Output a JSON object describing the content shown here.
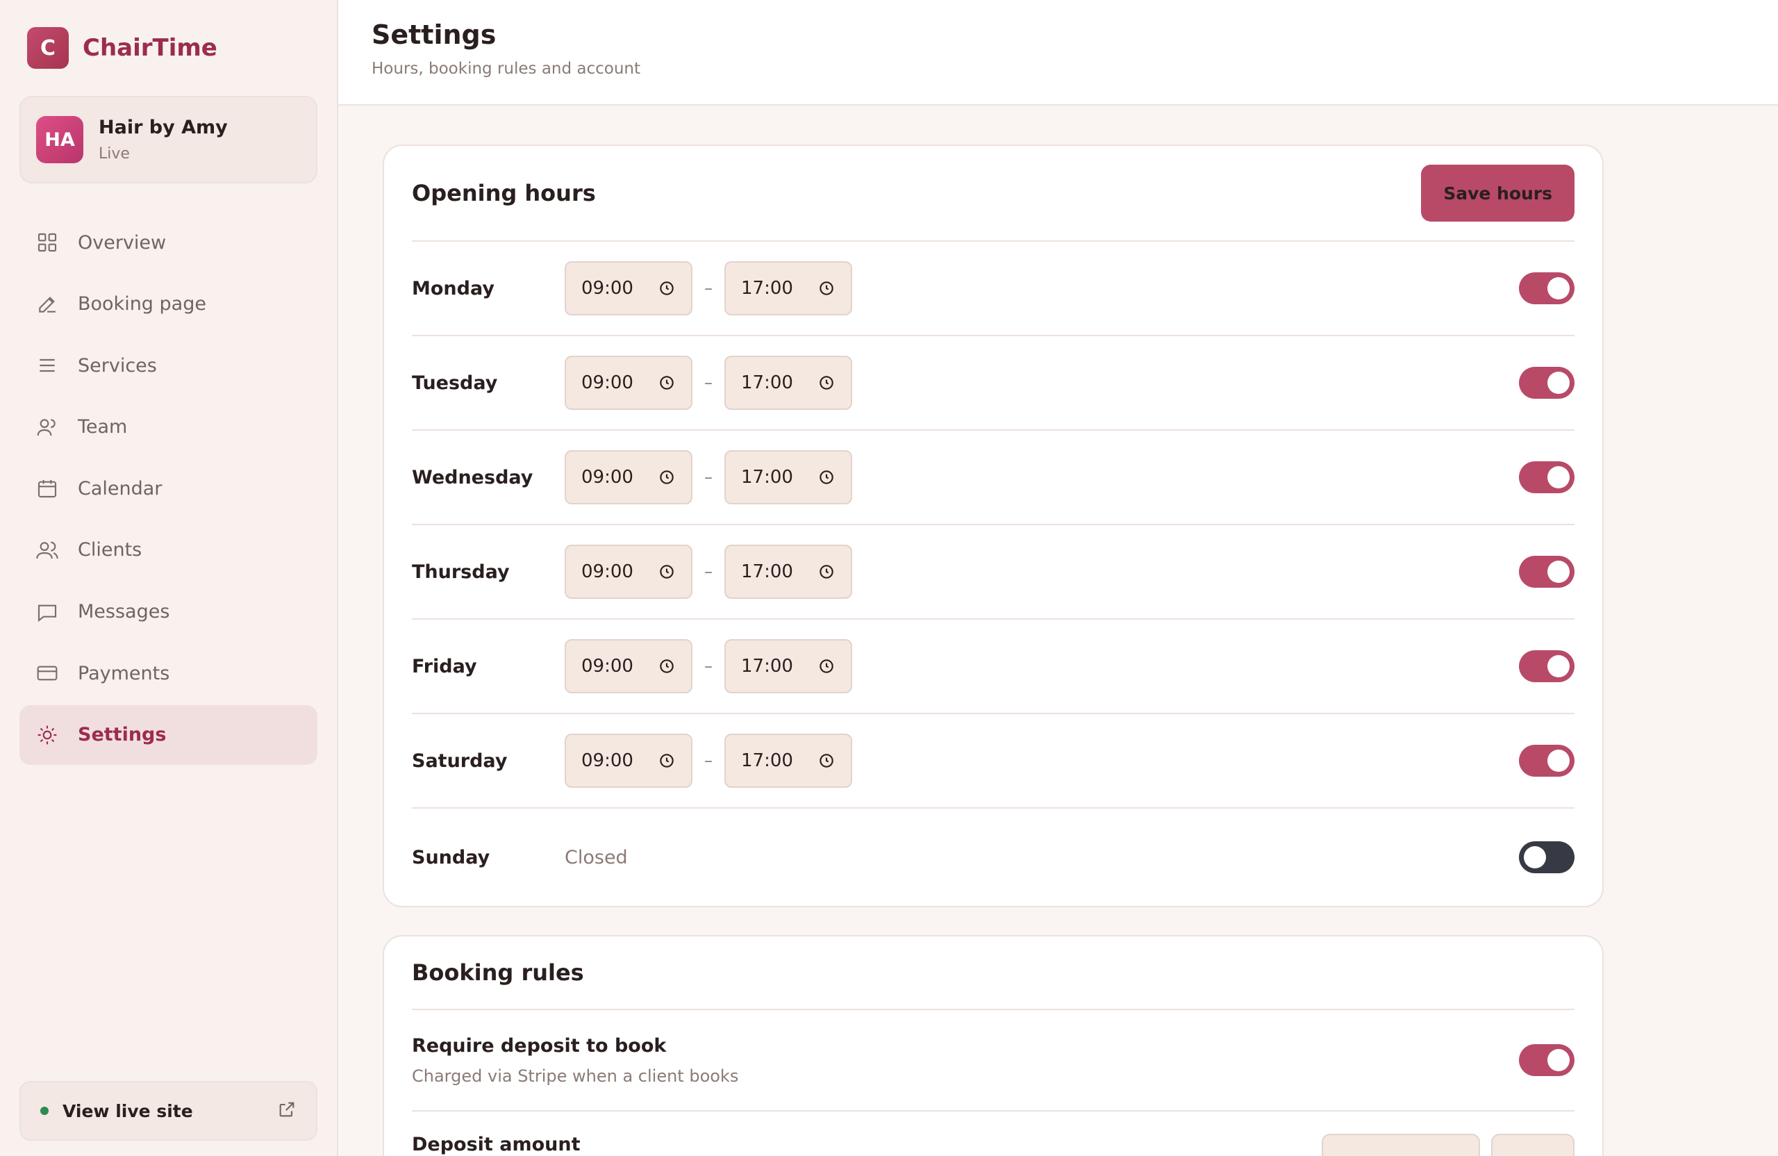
{
  "brand": {
    "logo_letter": "C",
    "name": "ChairTime"
  },
  "salon": {
    "initials": "HA",
    "name": "Hair by Amy",
    "status": "Live"
  },
  "nav": [
    {
      "label": "Overview",
      "icon": "grid-icon",
      "active": false
    },
    {
      "label": "Booking page",
      "icon": "pencil-icon",
      "active": false
    },
    {
      "label": "Services",
      "icon": "menu-icon",
      "active": false
    },
    {
      "label": "Team",
      "icon": "user-icon",
      "active": false
    },
    {
      "label": "Calendar",
      "icon": "calendar-icon",
      "active": false
    },
    {
      "label": "Clients",
      "icon": "users-icon",
      "active": false
    },
    {
      "label": "Messages",
      "icon": "message-icon",
      "active": false
    },
    {
      "label": "Payments",
      "icon": "card-icon",
      "active": false
    },
    {
      "label": "Settings",
      "icon": "sun-icon",
      "active": true
    }
  ],
  "live_site": {
    "label": "View live site"
  },
  "header": {
    "title": "Settings",
    "subtitle": "Hours, booking rules and account"
  },
  "opening_hours": {
    "title": "Opening hours",
    "save_label": "Save hours",
    "separator": "–",
    "days": [
      {
        "day": "Monday",
        "open": "09:00",
        "close": "17:00",
        "enabled": true
      },
      {
        "day": "Tuesday",
        "open": "09:00",
        "close": "17:00",
        "enabled": true
      },
      {
        "day": "Wednesday",
        "open": "09:00",
        "close": "17:00",
        "enabled": true
      },
      {
        "day": "Thursday",
        "open": "09:00",
        "close": "17:00",
        "enabled": true
      },
      {
        "day": "Friday",
        "open": "09:00",
        "close": "17:00",
        "enabled": true
      },
      {
        "day": "Saturday",
        "open": "09:00",
        "close": "17:00",
        "enabled": true
      },
      {
        "day": "Sunday",
        "closed_label": "Closed",
        "enabled": false
      }
    ]
  },
  "booking_rules": {
    "title": "Booking rules",
    "deposit": {
      "title": "Require deposit to book",
      "description": "Charged via Stripe when a client books",
      "enabled": true
    },
    "deposit_amount": {
      "title": "Deposit amount"
    }
  },
  "colors": {
    "accent": "#b84a68",
    "brand": "#9c2c4d",
    "toggle_off": "#373a44"
  }
}
